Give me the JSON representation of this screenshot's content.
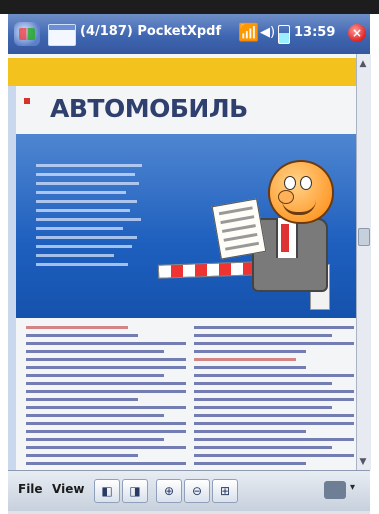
{
  "titlebar": {
    "title": "(4/187) PocketXpdf",
    "time": "13:59",
    "close_label": "×"
  },
  "document": {
    "title": "АВТОМОБИЛЬ",
    "subtitle": "",
    "panel_lines": []
  },
  "toolbar": {
    "file_label": "File",
    "view_label": "View",
    "prev_page_glyph": "◧",
    "next_page_glyph": "◨",
    "zoom_in_glyph": "⊕",
    "zoom_out_glyph": "⊖",
    "zoom_fit_glyph": "⊞",
    "sip_arrow_glyph": "▾"
  },
  "scrollbar": {
    "up_glyph": "▲",
    "down_glyph": "▼"
  },
  "icons": {
    "start": "windows-start-icon",
    "document": "document-icon",
    "antenna": "antenna-icon",
    "volume": "volume-icon",
    "battery": "battery-icon",
    "close": "close-icon"
  },
  "colors": {
    "titlebar": "#3f66b1",
    "accent_yellow": "#f4c21c",
    "panel_blue": "#1e5fbe"
  }
}
